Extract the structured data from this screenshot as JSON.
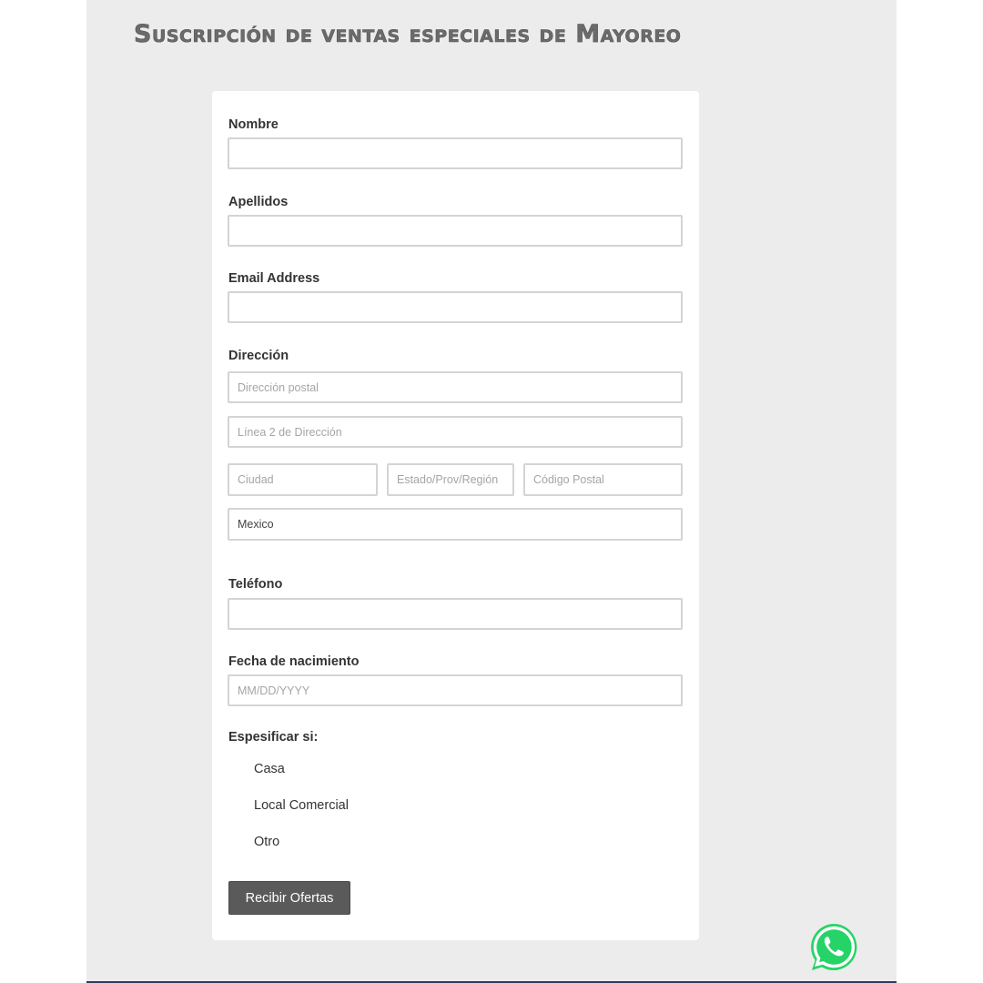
{
  "header": {
    "title": "Suscripción de ventas especiales de Mayoreo"
  },
  "form": {
    "nombre_label": "Nombre",
    "apellidos_label": "Apellidos",
    "email_label": "Email Address",
    "direccion_label": "Dirección",
    "address": {
      "street_placeholder": "Dirección postal",
      "line2_placeholder": "Línea 2 de Dirección",
      "city_placeholder": "Ciudad",
      "state_placeholder": "Estado/Prov/Región",
      "zip_placeholder": "Código Postal",
      "country_value": "Mexico"
    },
    "telefono_label": "Teléfono",
    "birth_label": "Fecha de nacimiento",
    "birth_placeholder": "MM/DD/YYYY",
    "specify_label": "Espesificar si:",
    "options": [
      "Casa",
      "Local Comercial",
      "Otro"
    ],
    "submit_label": "Recibir Ofertas"
  },
  "colors": {
    "page_bg": "#ececec",
    "card_bg": "#ffffff",
    "button_bg": "#5a5a5a",
    "whatsapp_green": "#25d366"
  },
  "icons": {
    "floating": "whatsapp-icon"
  }
}
